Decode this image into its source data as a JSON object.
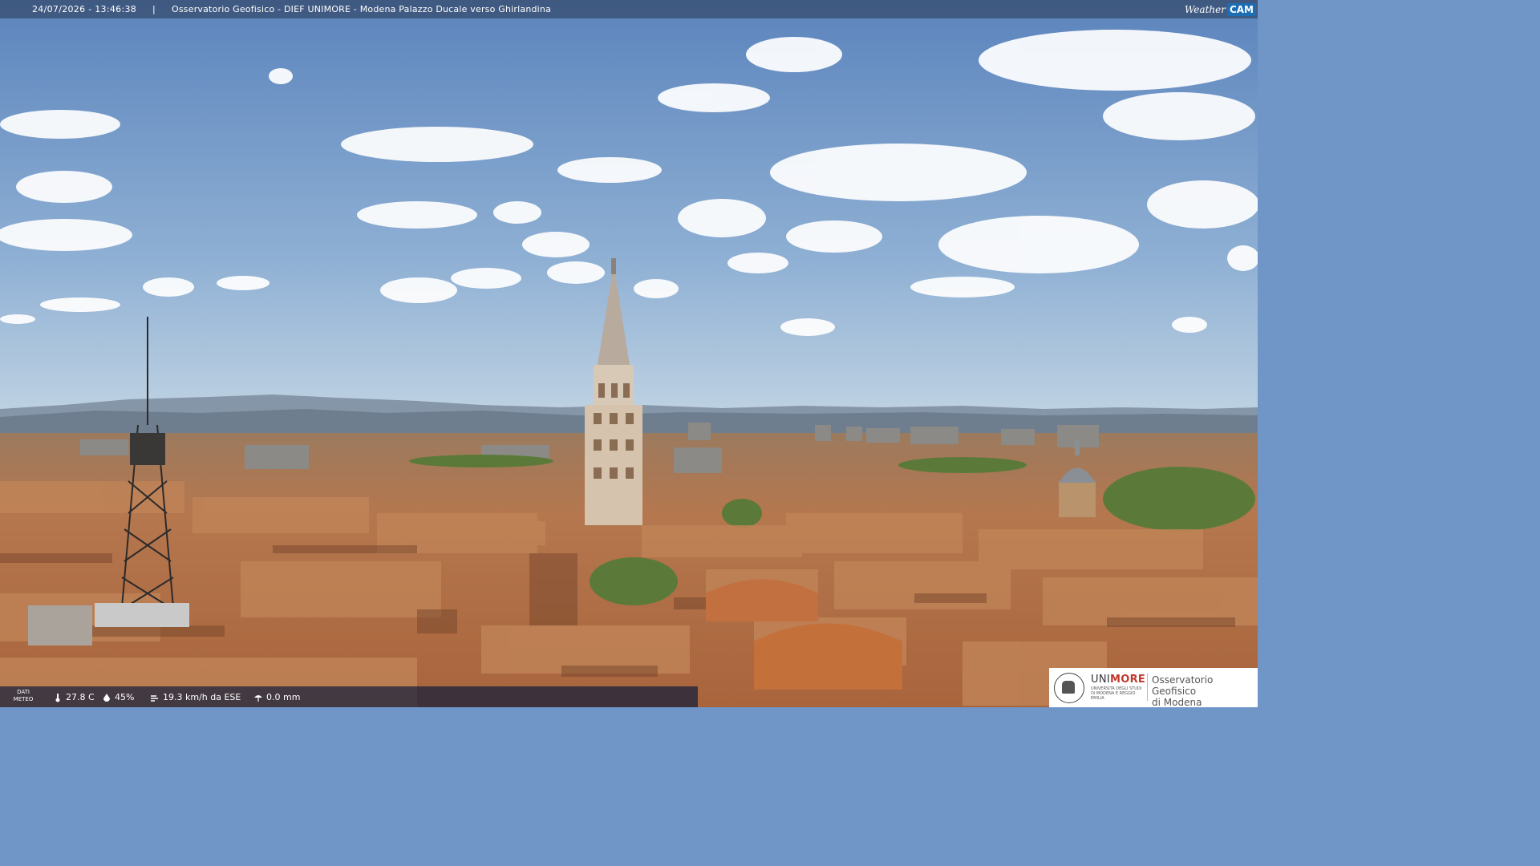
{
  "header": {
    "timestamp": "24/07/2026 - 13:46:38",
    "separator": "|",
    "title": "Osservatorio Geofisico - DIEF UNIMORE - Modena Palazzo Ducale verso Ghirlandina",
    "brand_weather": "Weather",
    "brand_cam": "CAM"
  },
  "weather_bar": {
    "label_line1": "DATI",
    "label_line2": "METEO",
    "temperature": "27.8 C",
    "humidity": "45%",
    "wind": "19.3 km/h da ESE",
    "rain": "0.0 mm",
    "icons": [
      "thermometer-icon",
      "humidity-icon",
      "wind-icon",
      "rain-icon"
    ]
  },
  "logo": {
    "uni_prefix": "UNI",
    "uni_suffix": "MORE",
    "uni_subtitle": "UNIVERSITÀ DEGLI STUDI DI MODENA E REGGIO EMILIA",
    "observatory_line1": "Osservatorio Geofisico",
    "observatory_line2": "di Modena"
  },
  "colors": {
    "sky_top": "#5d86be",
    "sky_horizon": "#b6cde0",
    "roof": "#b7764d",
    "brand_blue": "#1d6db5",
    "unimore_red": "#c0392b"
  }
}
